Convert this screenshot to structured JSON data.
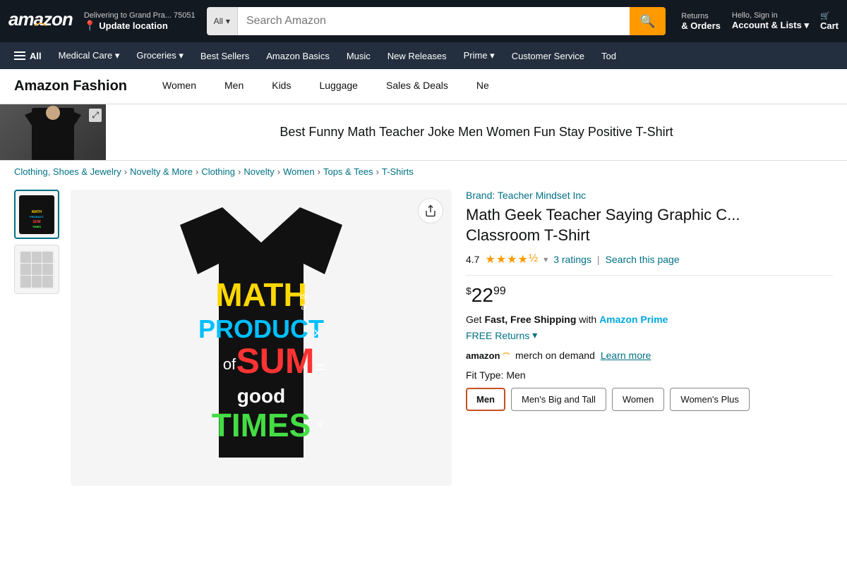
{
  "topnav": {
    "logo": "amazon",
    "logo_smile": "⌒",
    "delivery_label": "Delivering to Grand Pra... 75051",
    "update_location": "Update location",
    "search_placeholder": "Search Amazon",
    "search_category": "All",
    "nav_items": [
      {
        "line1": "Returns",
        "line2": "& Orders"
      },
      {
        "line1": "Hello, Sign in",
        "line2": "Account & Lists"
      },
      {
        "line1": "",
        "line2": "Cart"
      }
    ]
  },
  "secondnav": {
    "all_label": "All",
    "items": [
      "Medical Care",
      "Groceries",
      "Best Sellers",
      "Amazon Basics",
      "Music",
      "New Releases",
      "Prime",
      "Customer Service",
      "Tod"
    ]
  },
  "fashionnav": {
    "title": "Amazon Fashion",
    "items": [
      "Women",
      "Men",
      "Kids",
      "Luggage",
      "Sales & Deals",
      "Ne"
    ]
  },
  "banner": {
    "title": "Best Funny Math Teacher Joke Men Women Fun Stay Positive T-Shirt"
  },
  "breadcrumb": {
    "items": [
      "Clothing, Shoes & Jewelry",
      "Novelty & More",
      "Clothing",
      "Novelty",
      "Women",
      "Tops & Tees",
      "T-Shirts"
    ]
  },
  "product": {
    "brand_label": "Brand: Teacher Mindset Inc",
    "title": "Math Geek Teacher Saying Graphic C... Classroom T-Shirt",
    "rating": "4.7",
    "ratings_count": "3 ratings",
    "search_page": "Search this page",
    "price_dollar": "$",
    "price_main": "22",
    "price_cents": "99",
    "shipping_text1": "Get ",
    "shipping_bold": "Fast, Free Shipping",
    "shipping_text2": " with ",
    "prime_label": "Amazon Prime",
    "free_returns": "FREE Returns",
    "merch_label": "merch on demand",
    "learn_more": "Learn more",
    "fit_label": "Fit Type:",
    "fit_value": "Men",
    "sizes": [
      "Men",
      "Men's Big and Tall",
      "Women",
      "Women's Plus"
    ],
    "selected_size": "Men"
  }
}
